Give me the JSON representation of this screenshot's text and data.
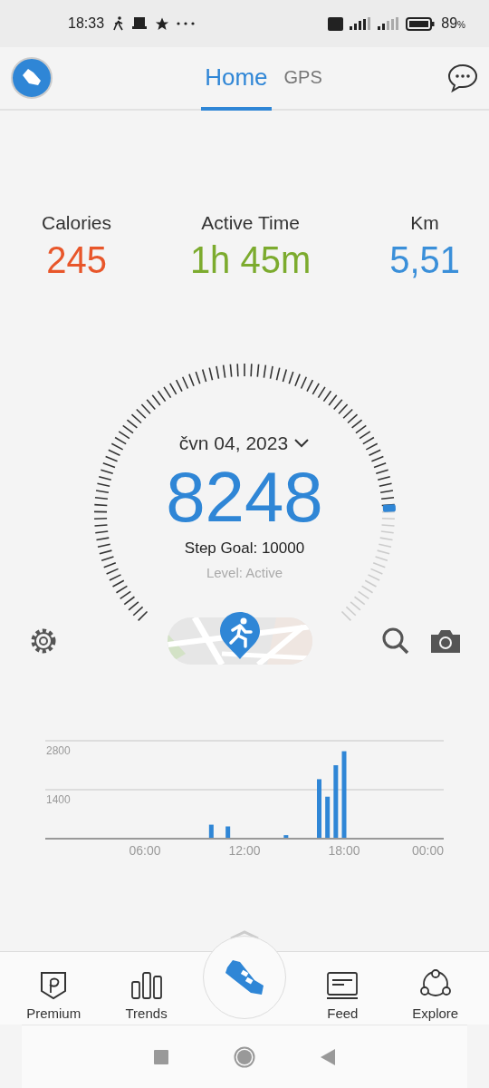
{
  "status_bar": {
    "time": "18:33",
    "battery": "89",
    "battery_unit": "%"
  },
  "tabs": [
    {
      "label": "Home",
      "selected": true
    },
    {
      "label": "GPS",
      "selected": false
    }
  ],
  "stats": [
    {
      "label": "Calories",
      "value": "245",
      "color": "#e8562a"
    },
    {
      "label": "Active Time",
      "value": "1h 45m",
      "color": "#7cab2e"
    },
    {
      "label": "Km",
      "value": "5,51",
      "color": "#3a8fd9"
    }
  ],
  "gauge": {
    "date": "čvn 04, 2023",
    "steps": "8248",
    "goal": "Step Goal: 10000",
    "level_text": "Level: Active"
  },
  "chart": {
    "chart_data": {
      "type": "bar",
      "x": [
        10,
        11,
        14.5,
        16.5,
        17,
        17.5,
        18
      ],
      "series": [
        {
          "color": "#2f86d6",
          "values": [
            400,
            350,
            100,
            1700,
            1200,
            2100,
            2500
          ]
        }
      ],
      "xlim": [
        0,
        24
      ],
      "ylim": [
        0,
        2800
      ],
      "xticks": [
        {
          "value": 6,
          "label": "06:00"
        },
        {
          "value": 12,
          "label": "12:00"
        },
        {
          "value": 18,
          "label": "18:00"
        },
        {
          "value": 24,
          "label": "00:00"
        }
      ],
      "yticks": [
        1400,
        2800
      ]
    }
  },
  "nav": [
    {
      "label": "Premium",
      "kind": "premium"
    },
    {
      "label": "Trends",
      "kind": "trends"
    },
    {
      "kind": "center"
    },
    {
      "label": "Feed",
      "kind": "feed"
    },
    {
      "label": "Explore",
      "kind": "explore"
    }
  ]
}
